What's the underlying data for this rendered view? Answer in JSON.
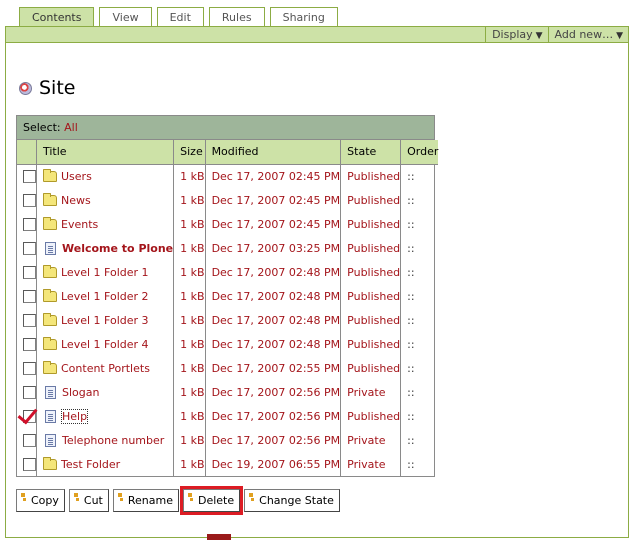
{
  "tabs": [
    {
      "label": "Contents",
      "active": true
    },
    {
      "label": "View",
      "active": false
    },
    {
      "label": "Edit",
      "active": false
    },
    {
      "label": "Rules",
      "active": false
    },
    {
      "label": "Sharing",
      "active": false
    }
  ],
  "actions": [
    {
      "label": "Display",
      "arrow": "▼"
    },
    {
      "label": "Add new…",
      "arrow": "▼"
    }
  ],
  "page": {
    "title": "Site",
    "icon": "site-icon"
  },
  "listing": {
    "select_label": "Select:",
    "select_all": "All",
    "headers": {
      "title": "Title",
      "size": "Size",
      "modified": "Modified",
      "state": "State",
      "order": "Order"
    },
    "rows": [
      {
        "title": "Users",
        "type": "folder",
        "size": "1 kB",
        "modified": "Dec 17, 2007 02:45 PM",
        "state": "Published",
        "order": "::",
        "checked": false
      },
      {
        "title": "News",
        "type": "folder",
        "size": "1 kB",
        "modified": "Dec 17, 2007 02:45 PM",
        "state": "Published",
        "order": "::",
        "checked": false
      },
      {
        "title": "Events",
        "type": "folder",
        "size": "1 kB",
        "modified": "Dec 17, 2007 02:45 PM",
        "state": "Published",
        "order": "::",
        "checked": false
      },
      {
        "title": "Welcome to Plone",
        "type": "document",
        "size": "1 kB",
        "modified": "Dec 17, 2007 03:25 PM",
        "state": "Published",
        "order": "::",
        "checked": false,
        "bold": true
      },
      {
        "title": "Level 1 Folder 1",
        "type": "folder",
        "size": "1 kB",
        "modified": "Dec 17, 2007 02:48 PM",
        "state": "Published",
        "order": "::",
        "checked": false
      },
      {
        "title": "Level 1 Folder 2",
        "type": "folder",
        "size": "1 kB",
        "modified": "Dec 17, 2007 02:48 PM",
        "state": "Published",
        "order": "::",
        "checked": false
      },
      {
        "title": "Level 1 Folder 3",
        "type": "folder",
        "size": "1 kB",
        "modified": "Dec 17, 2007 02:48 PM",
        "state": "Published",
        "order": "::",
        "checked": false
      },
      {
        "title": "Level 1 Folder 4",
        "type": "folder",
        "size": "1 kB",
        "modified": "Dec 17, 2007 02:48 PM",
        "state": "Published",
        "order": "::",
        "checked": false
      },
      {
        "title": "Content Portlets",
        "type": "folder",
        "size": "1 kB",
        "modified": "Dec 17, 2007 02:55 PM",
        "state": "Published",
        "order": "::",
        "checked": false
      },
      {
        "title": "Slogan",
        "type": "document",
        "size": "1 kB",
        "modified": "Dec 17, 2007 02:56 PM",
        "state": "Private",
        "order": "::",
        "checked": false
      },
      {
        "title": "Help",
        "type": "document",
        "size": "1 kB",
        "modified": "Dec 17, 2007 02:56 PM",
        "state": "Published",
        "order": "::",
        "checked": true,
        "focused": true
      },
      {
        "title": "Telephone number",
        "type": "document",
        "size": "1 kB",
        "modified": "Dec 17, 2007 02:56 PM",
        "state": "Private",
        "order": "::",
        "checked": false
      },
      {
        "title": "Test Folder",
        "type": "folder",
        "size": "1 kB",
        "modified": "Dec 19, 2007 06:55 PM",
        "state": "Private",
        "order": "::",
        "checked": false
      }
    ]
  },
  "buttons": [
    {
      "label": "Copy",
      "name": "copy-button"
    },
    {
      "label": "Cut",
      "name": "cut-button"
    },
    {
      "label": "Rename",
      "name": "rename-button"
    },
    {
      "label": "Delete",
      "name": "delete-button",
      "highlight": true
    },
    {
      "label": "Change State",
      "name": "change-state-button"
    }
  ],
  "colors": {
    "accent": "#cde2a7",
    "border": "#8cac44",
    "link": "#a4151b",
    "select_bar": "#9eb59a",
    "highlight": "#dc1c24"
  }
}
